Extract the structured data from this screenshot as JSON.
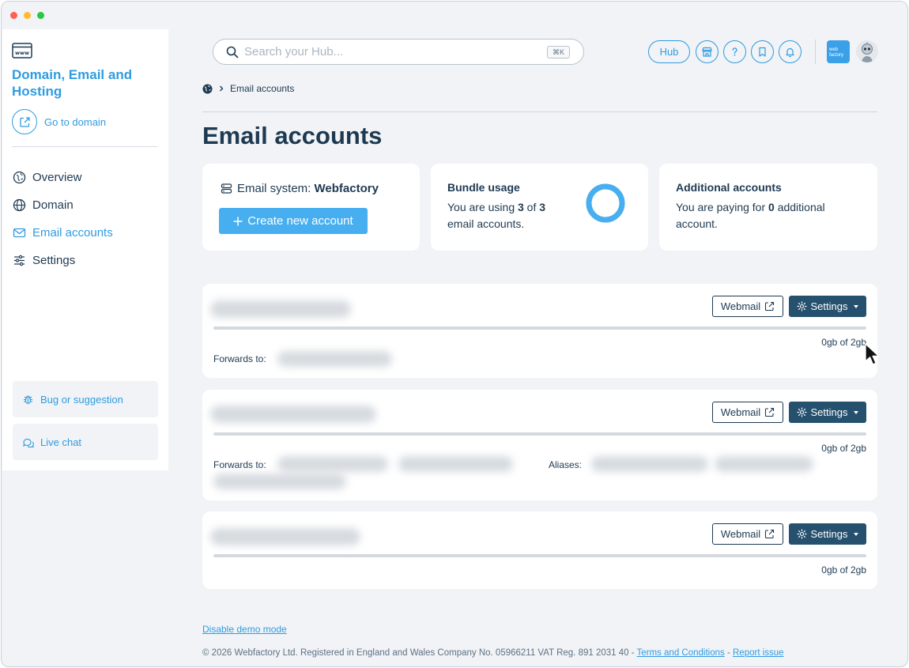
{
  "sidebar": {
    "title": "Domain, Email and Hosting",
    "goto_label": "Go to domain",
    "items": [
      {
        "label": "Overview",
        "icon": "overview-icon"
      },
      {
        "label": "Domain",
        "icon": "globe-icon"
      },
      {
        "label": "Email accounts",
        "icon": "mail-icon",
        "active": true
      },
      {
        "label": "Settings",
        "icon": "sliders-icon"
      }
    ],
    "bug_label": "Bug or suggestion",
    "chat_label": "Live chat"
  },
  "topbar": {
    "search_placeholder": "Search your Hub...",
    "search_shortcut": "⌘K",
    "hub_label": "Hub",
    "brand_text": "web factory"
  },
  "breadcrumb": {
    "current": "Email accounts"
  },
  "page": {
    "title": "Email accounts"
  },
  "cards": {
    "email_system_prefix": "Email system: ",
    "email_system_name": "Webfactory",
    "create_label": "Create new account",
    "bundle": {
      "title": "Bundle usage",
      "text_prefix": "You are using ",
      "used": "3",
      "text_mid": " of ",
      "total": "3",
      "text_suffix": " email accounts.",
      "fraction": 1.0
    },
    "additional": {
      "title": "Additional accounts",
      "text_prefix": "You are paying for ",
      "count": "0",
      "text_suffix": " additional account."
    }
  },
  "accounts": {
    "webmail_label": "Webmail",
    "settings_label": "Settings",
    "forwards_label": "Forwards to:",
    "aliases_label": "Aliases:",
    "list": [
      {
        "usage": "0gb of 2gb",
        "usage_fraction": 0.0
      },
      {
        "usage": "0gb of 2gb",
        "usage_fraction": 0.0
      },
      {
        "usage": "0gb of 2gb",
        "usage_fraction": 0.0
      }
    ]
  },
  "footer": {
    "demo_link": "Disable demo mode",
    "copyright": "© 2026 Webfactory Ltd. Registered in England and Wales Company No. 05966211 VAT Reg. 891 2031 40 - ",
    "terms": "Terms and Conditions",
    "sep": " - ",
    "report": "Report issue"
  },
  "colors": {
    "accent": "#2f9ce0",
    "primary_dark": "#25506e",
    "text": "#1e3a52",
    "background": "#f1f3f6"
  }
}
